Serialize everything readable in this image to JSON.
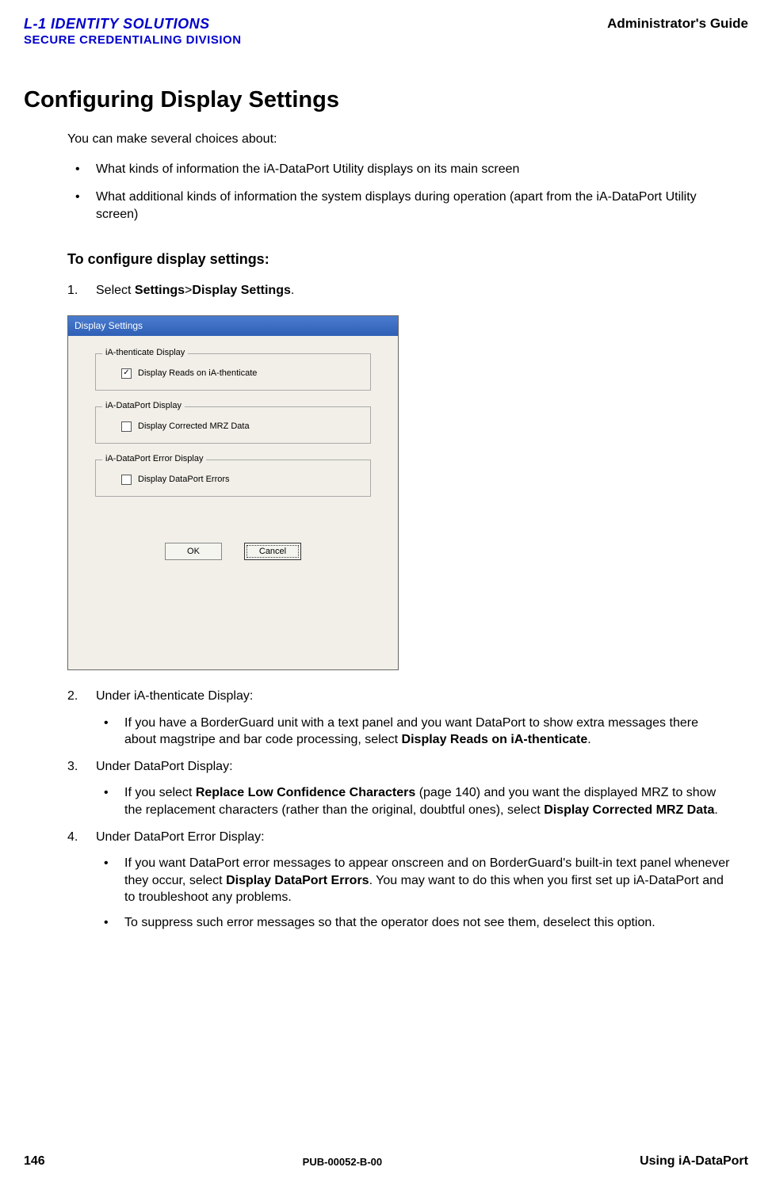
{
  "header": {
    "logo_line1": "L-1 IDENTITY SOLUTIONS",
    "logo_line2": "SECURE CREDENTIALING DIVISION",
    "right": "Administrator's Guide"
  },
  "title": "Configuring Display Settings",
  "intro": "You can make several choices about:",
  "bullets": [
    "What kinds of information the iA-DataPort Utility displays on its main screen",
    "What additional kinds of information the system displays during operation (apart from the iA-DataPort Utility screen)"
  ],
  "h2": "To configure display settings:",
  "step1": {
    "num": "1.",
    "pre": "Select ",
    "bold1": "Settings",
    "sep": ">",
    "bold2": "Display Settings",
    "post": "."
  },
  "dialog": {
    "title": "Display Settings",
    "group1": {
      "legend": "iA-thenticate Display",
      "cb_checked": true,
      "cb_label": "Display Reads on iA-thenticate"
    },
    "group2": {
      "legend": "iA-DataPort Display",
      "cb_checked": false,
      "cb_label": "Display Corrected MRZ Data"
    },
    "group3": {
      "legend": "iA-DataPort Error Display",
      "cb_checked": false,
      "cb_label": "Display DataPort Errors"
    },
    "ok": "OK",
    "cancel": "Cancel"
  },
  "step2": {
    "num": "2.",
    "text": "Under iA-thenticate Display:",
    "sub": {
      "pre": "If you have a BorderGuard unit with a text panel and you want DataPort to show extra messages there about magstripe and bar code processing, select ",
      "bold": "Display Reads on iA-thenticate",
      "post": "."
    }
  },
  "step3": {
    "num": "3.",
    "text": "Under DataPort Display:",
    "sub": {
      "pre": "If you select ",
      "bold1": "Replace Low Confidence Characters",
      "mid": " (page 140) and you want the displayed MRZ to show the replacement characters (rather than the original, doubtful ones), select ",
      "bold2": "Display Corrected MRZ Data",
      "post": "."
    }
  },
  "step4": {
    "num": "4.",
    "text": "Under DataPort Error Display:",
    "sub1": {
      "pre": "If you want DataPort error messages to appear onscreen and on BorderGuard's built-in text panel whenever they occur, select ",
      "bold": "Display DataPort Errors",
      "post": ". You may want to do this when you first set up iA-DataPort and to troubleshoot any problems."
    },
    "sub2": "To suppress such error messages so that the operator does not see them, deselect this option."
  },
  "footer": {
    "left": "146",
    "center": "PUB-00052-B-00",
    "right": "Using iA-DataPort"
  }
}
